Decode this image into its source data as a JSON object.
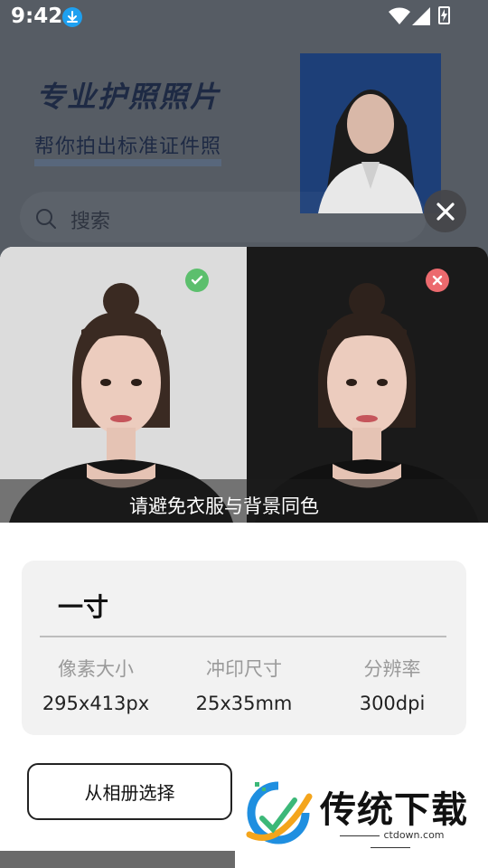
{
  "status_bar": {
    "time": "9:42",
    "icons": [
      "download-icon",
      "wifi-icon",
      "signal-icon",
      "battery-icon"
    ]
  },
  "background": {
    "banner_title": "专业护照照片",
    "banner_subtitle": "帮你拍出标准证件照",
    "search_placeholder": "搜索"
  },
  "dialog": {
    "close_icon": "close-icon",
    "good_example_icon": "check-icon",
    "bad_example_icon": "cross-icon",
    "caption": "请避免衣服与背景同色",
    "spec": {
      "title": "一寸",
      "columns": [
        {
          "label": "像素大小",
          "value": "295x413px"
        },
        {
          "label": "冲印尺寸",
          "value": "25x35mm"
        },
        {
          "label": "分辨率",
          "value": "300dpi"
        }
      ]
    },
    "album_button": "从相册选择"
  },
  "watermark": {
    "brand": "传统下载",
    "url": "ctdown.com"
  },
  "colors": {
    "overlay": "#565c64",
    "banner_blue": "#1d3f78",
    "good": "#5cbf6d",
    "bad": "#ec6a6e"
  }
}
